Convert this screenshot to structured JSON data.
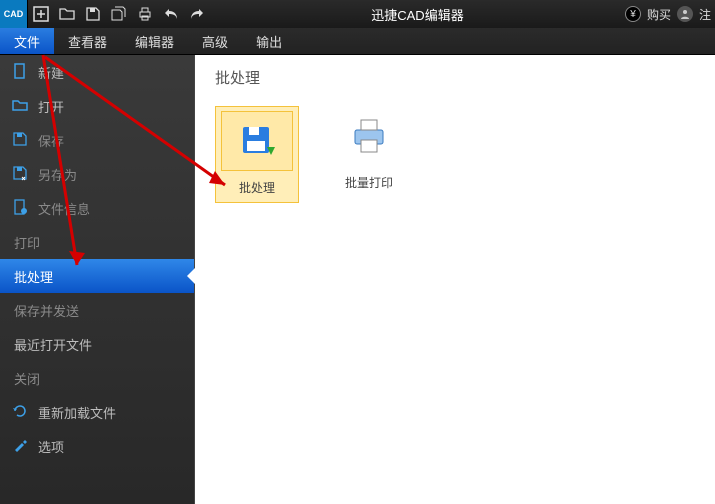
{
  "title": "迅捷CAD编辑器",
  "titlebar_right": {
    "buy": "购买",
    "user": "注"
  },
  "menu": [
    "文件",
    "查看器",
    "编辑器",
    "高级",
    "输出"
  ],
  "menu_active": 0,
  "sidebar": {
    "items": [
      {
        "label": "新建",
        "icon": "new"
      },
      {
        "label": "打开",
        "icon": "open"
      },
      {
        "label": "保存",
        "icon": "save",
        "gray": true
      },
      {
        "label": "另存为",
        "icon": "saveas",
        "gray": true
      },
      {
        "label": "文件信息",
        "icon": "info",
        "gray": true
      },
      {
        "label": "打印",
        "noicon": true,
        "gray": true
      },
      {
        "label": "批处理",
        "noicon": true,
        "active": true
      },
      {
        "label": "保存并发送",
        "noicon": true,
        "gray": true
      },
      {
        "label": "最近打开文件",
        "noicon": true
      },
      {
        "label": "关闭",
        "noicon": true,
        "gray": true
      },
      {
        "label": "重新加载文件",
        "icon": "reload"
      },
      {
        "label": "选项",
        "icon": "options"
      }
    ]
  },
  "content": {
    "heading": "批处理",
    "tiles": [
      {
        "label": "批处理",
        "icon": "batch-save",
        "selected": true
      },
      {
        "label": "批量打印",
        "icon": "batch-print"
      }
    ]
  }
}
